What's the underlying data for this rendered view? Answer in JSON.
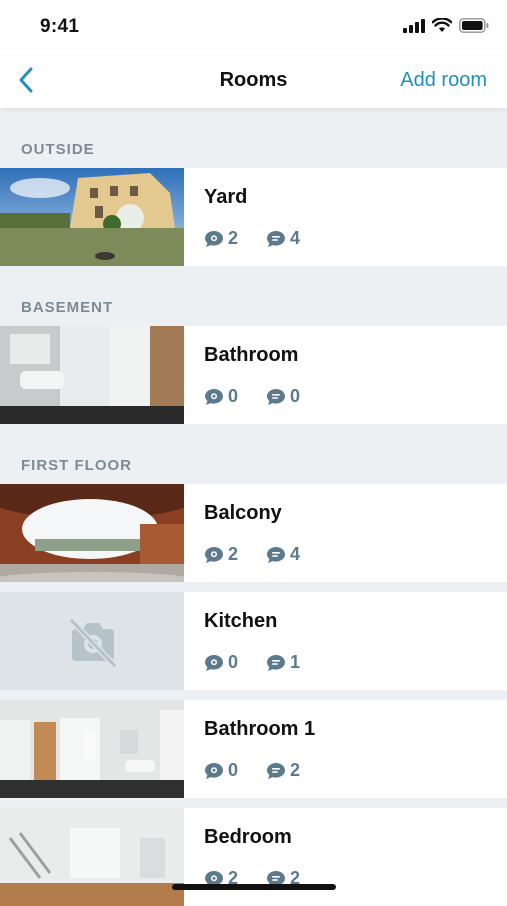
{
  "status": {
    "time": "9:41",
    "icons": [
      "signal-icon",
      "wifi-icon",
      "battery-icon"
    ]
  },
  "nav": {
    "back_icon": "chevron-left-icon",
    "title": "Rooms",
    "add_label": "Add room"
  },
  "colors": {
    "accent": "#1f8fbf",
    "count_color": "#5c7a8c",
    "section_text": "#7b8b96",
    "background": "#edf0f2"
  },
  "sections": [
    {
      "title": "OUTSIDE",
      "rooms": [
        {
          "name": "Yard",
          "image": "yard-panorama",
          "comments": "2",
          "notes": "4"
        }
      ]
    },
    {
      "title": "BASEMENT",
      "rooms": [
        {
          "name": "Bathroom",
          "image": "bathroom-panorama",
          "comments": "0",
          "notes": "0"
        }
      ]
    },
    {
      "title": "FIRST FLOOR",
      "rooms": [
        {
          "name": "Balcony",
          "image": "balcony-panorama",
          "comments": "2",
          "notes": "4"
        },
        {
          "name": "Kitchen",
          "image": "no-photo-icon",
          "comments": "0",
          "notes": "1"
        },
        {
          "name": "Bathroom 1",
          "image": "bathroom1-panorama",
          "comments": "0",
          "notes": "2"
        },
        {
          "name": "Bedroom",
          "image": "bedroom-panorama",
          "comments": "2",
          "notes": "2"
        }
      ]
    }
  ]
}
